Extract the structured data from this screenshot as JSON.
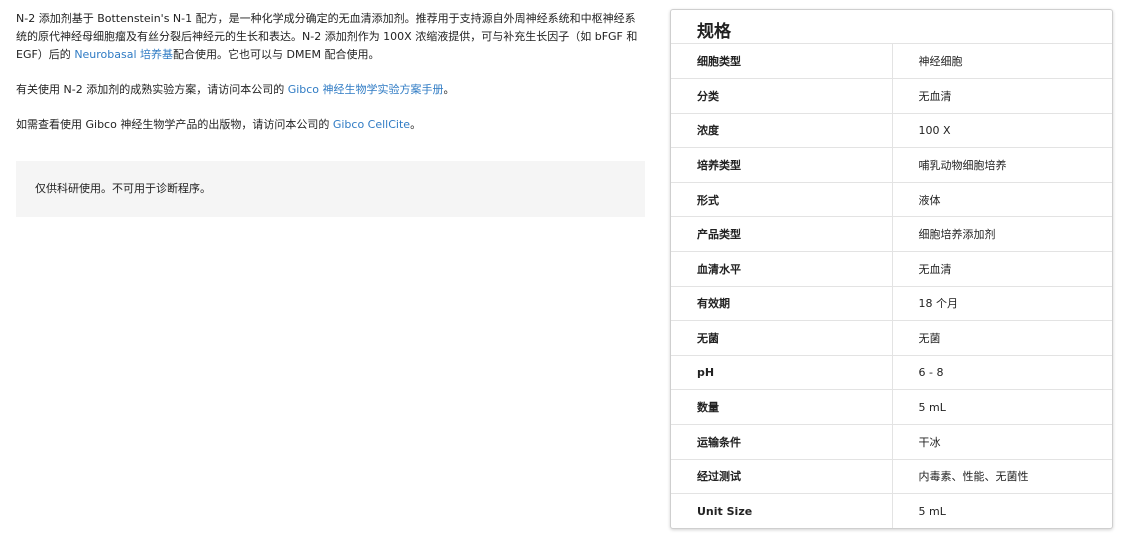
{
  "description": {
    "p1": {
      "text_before": "N-2 添加剂基于 Bottenstein's N-1 配方，是一种化学成分确定的无血清添加剂。推荐用于支持源自外周神经系统和中枢神经系统的原代神经母细胞瘤及有丝分裂后神经元的生长和表达。N-2 添加剂作为 100X 浓缩液提供，可与补充生长因子（如 bFGF 和 EGF）后的 ",
      "link": "Neurobasal 培养基",
      "text_after": "配合使用。它也可以与 DMEM 配合使用。"
    },
    "p2": {
      "text_before": "有关使用 N-2 添加剂的成熟实验方案，请访问本公司的 ",
      "link": "Gibco 神经生物学实验方案手册",
      "text_after": "。"
    },
    "p3": {
      "text_before": "如需查看使用 Gibco 神经生物学产品的出版物，请访问本公司的 ",
      "link": "Gibco CellCite",
      "text_after": "。"
    },
    "notice": "仅供科研使用。不可用于诊断程序。"
  },
  "specs": {
    "title": "规格",
    "rows": [
      {
        "label": "细胞类型",
        "value": "神经细胞"
      },
      {
        "label": "分类",
        "value": "无血清"
      },
      {
        "label": "浓度",
        "value": "100 X"
      },
      {
        "label": "培养类型",
        "value": "哺乳动物细胞培养"
      },
      {
        "label": "形式",
        "value": "液体"
      },
      {
        "label": "产品类型",
        "value": "细胞培养添加剂"
      },
      {
        "label": "血清水平",
        "value": "无血清"
      },
      {
        "label": "有效期",
        "value": "18 个月"
      },
      {
        "label": "无菌",
        "value": "无菌"
      },
      {
        "label": "pH",
        "value": "6 - 8"
      },
      {
        "label": "数量",
        "value": "5 mL"
      },
      {
        "label": "运输条件",
        "value": "干冰"
      },
      {
        "label": "经过测试",
        "value": "内毒素、性能、无菌性"
      },
      {
        "label": "Unit Size",
        "value": "5 mL"
      }
    ]
  },
  "colors": {
    "link": "#2f7bc4",
    "notice_bg": "#f5f5f5",
    "border": "#e3e3e3"
  }
}
